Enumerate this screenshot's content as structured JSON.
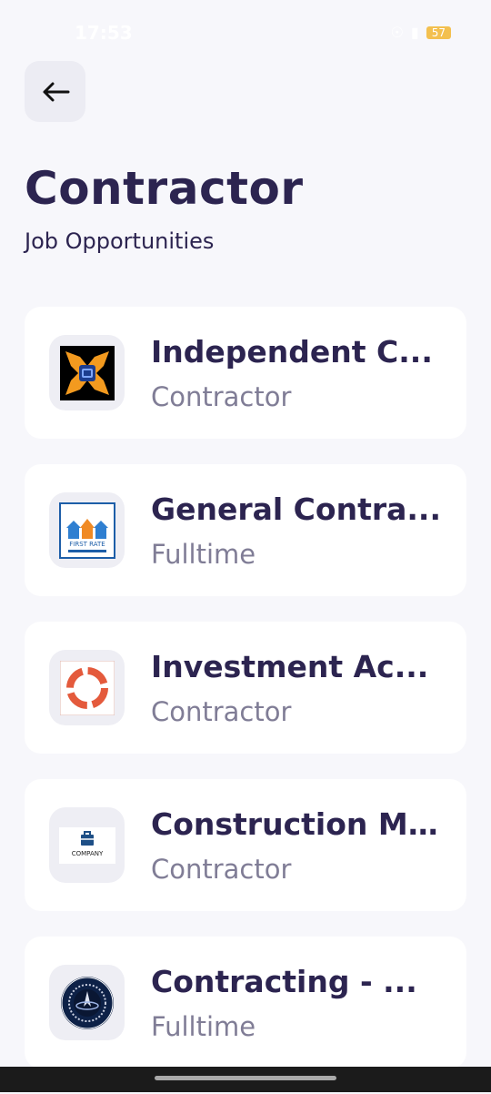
{
  "status_bar": {
    "time": "17:53",
    "battery": "57"
  },
  "header": {
    "back_icon": "arrow-left-icon",
    "title": "Contractor",
    "subtitle": "Job Opportunities"
  },
  "jobs": [
    {
      "title": "Independent C...",
      "type": "Contractor",
      "logo_icon": "independent-logo-icon"
    },
    {
      "title": "General Contra...",
      "type": "Fulltime",
      "logo_icon": "first-rate-logo-icon",
      "logo_text": "FIRST RATE"
    },
    {
      "title": "Investment Ac...",
      "type": "Contractor",
      "logo_icon": "ring-logo-icon"
    },
    {
      "title": "Construction M...",
      "type": "Contractor",
      "logo_icon": "company-logo-icon",
      "logo_text": "COMPANY"
    },
    {
      "title": "Contracting  - ...",
      "type": "Fulltime",
      "logo_icon": "space-force-seal-icon"
    }
  ]
}
